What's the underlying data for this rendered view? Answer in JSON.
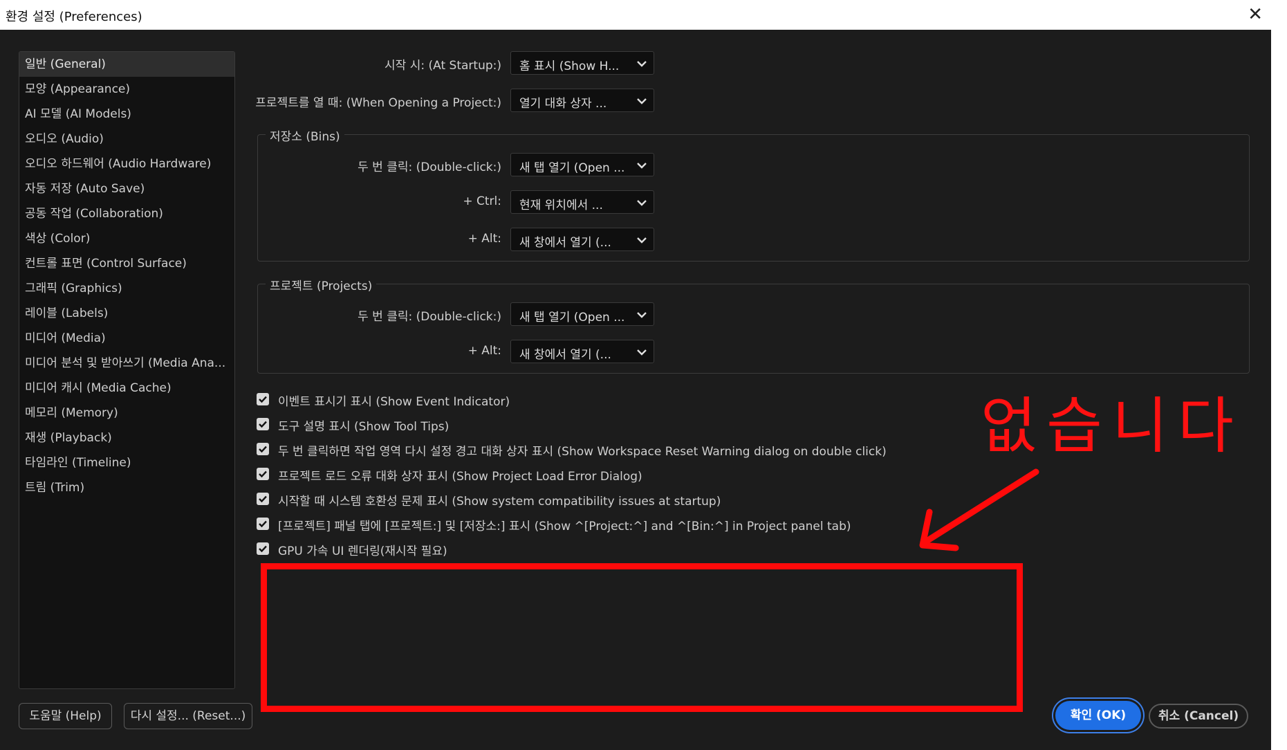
{
  "window": {
    "title": "환경 설정 (Preferences)",
    "close_glyph": "✕"
  },
  "sidebar": {
    "items": [
      {
        "label": "일반 (General)"
      },
      {
        "label": "모양 (Appearance)"
      },
      {
        "label": "AI 모델 (AI Models)"
      },
      {
        "label": "오디오 (Audio)"
      },
      {
        "label": "오디오 하드웨어 (Audio Hardware)"
      },
      {
        "label": "자동 저장 (Auto Save)"
      },
      {
        "label": "공동 작업 (Collaboration)"
      },
      {
        "label": "색상 (Color)"
      },
      {
        "label": "컨트롤 표면 (Control Surface)"
      },
      {
        "label": "그래픽 (Graphics)"
      },
      {
        "label": "레이블 (Labels)"
      },
      {
        "label": "미디어 (Media)"
      },
      {
        "label": "미디어 분석 및 받아쓰기 (Media Ana..."
      },
      {
        "label": "미디어 캐시 (Media Cache)"
      },
      {
        "label": "메모리 (Memory)"
      },
      {
        "label": "재생 (Playback)"
      },
      {
        "label": "타임라인 (Timeline)"
      },
      {
        "label": "트림 (Trim)"
      }
    ],
    "selected_index": 0
  },
  "general": {
    "startup": {
      "label": "시작 시: (At Startup:)",
      "value": "홈 표시  (Show H..."
    },
    "open_project": {
      "label": "프로젝트를 열 때: (When Opening a Project:)",
      "value": "열기 대화 상자 ..."
    },
    "bins": {
      "title": "저장소 (Bins)",
      "double_click": {
        "label": "두 번 클릭: (Double-click:)",
        "value": "새 탭 열기 (Open ..."
      },
      "ctrl": {
        "label": "+ Ctrl:",
        "value": "현재 위치에서 ..."
      },
      "alt": {
        "label": "+ Alt:",
        "value": "새 창에서 열기 (..."
      }
    },
    "projects": {
      "title": "프로젝트 (Projects)",
      "double_click": {
        "label": "두 번 클릭: (Double-click:)",
        "value": "새 탭 열기 (Open ..."
      },
      "alt": {
        "label": "+ Alt:",
        "value": "새 창에서 열기 (..."
      }
    },
    "checkboxes": [
      {
        "label": "이벤트 표시기 표시 (Show Event Indicator)",
        "checked": true
      },
      {
        "label": "도구 설명 표시 (Show Tool Tips)",
        "checked": true
      },
      {
        "label": "두 번 클릭하면 작업 영역 다시 설정 경고 대화 상자 표시 (Show Workspace Reset Warning dialog on double click)",
        "checked": true
      },
      {
        "label": "프로젝트 로드 오류 대화 상자 표시 (Show Project Load Error Dialog)",
        "checked": true
      },
      {
        "label": "시작할 때 시스템 호환성 문제 표시 (Show system compatibility issues at startup)",
        "checked": true
      },
      {
        "label": "[프로젝트] 패널 탭에 [프로젝트:] 및 [저장소:] 표시 (Show ^[Project:^] and ^[Bin:^] in Project panel tab)",
        "checked": true
      },
      {
        "label": "GPU 가속 UI 렌더링(재시작 필요)",
        "checked": true
      }
    ]
  },
  "annotation": {
    "text": "없습니다",
    "color": "#ff1111"
  },
  "buttons": {
    "help": "도움말 (Help)",
    "reset": "다시 설정... (Reset...)",
    "ok": "확인 (OK)",
    "cancel": "취소 (Cancel)"
  },
  "colors": {
    "accent": "#1f6fe5",
    "background": "#1c1c1c",
    "annotation": "#ff0a0a"
  },
  "icons": {
    "dropdown": "chevron-down-icon",
    "checkbox": "checkmark-icon",
    "close": "close-icon"
  }
}
